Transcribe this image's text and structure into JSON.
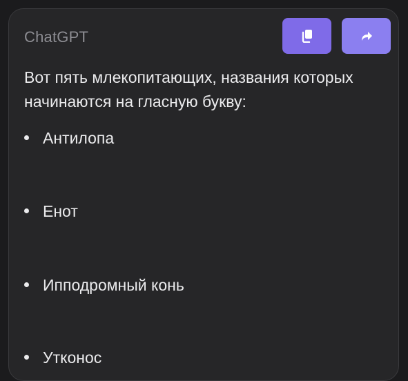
{
  "message": {
    "sender": "ChatGPT",
    "actions": {
      "copy_icon": "copy-icon",
      "share_icon": "share-icon"
    },
    "intro": "Вот пять млекопитающих, названия которых начинаются на гласную букву:",
    "items": [
      {
        "label": "Антилопа"
      },
      {
        "label": "Енот"
      },
      {
        "label": "Ипподромный конь"
      },
      {
        "label": "Утконос"
      }
    ]
  },
  "colors": {
    "background": "#1b1b1d",
    "card": "#262628",
    "accent": "#7f6be8",
    "text": "#ebebed",
    "muted": "#8d8d93"
  }
}
